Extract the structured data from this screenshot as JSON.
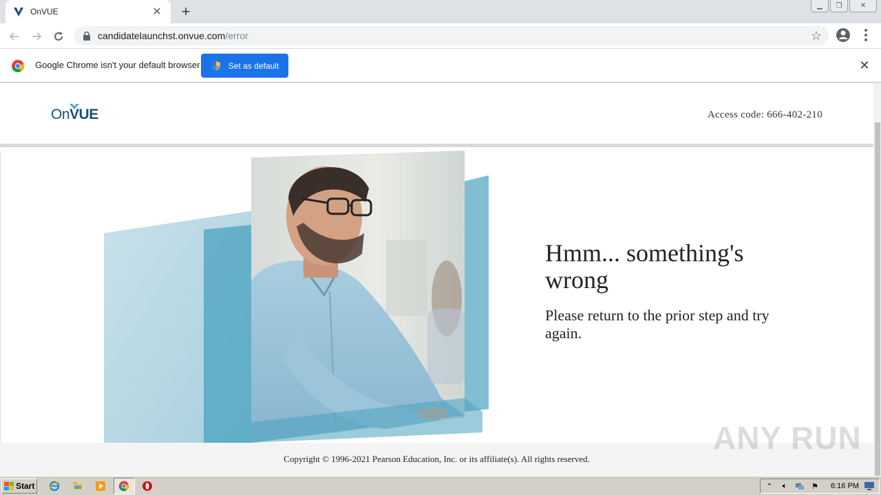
{
  "browser": {
    "tab_title": "OnVUE",
    "new_tab_symbol": "+",
    "url_host": "candidatelaunchst.onvue.com",
    "url_path": "/error",
    "infobar_text": "Google Chrome isn't your default browser",
    "set_default_label": "Set as default"
  },
  "site": {
    "logo_text_on": "On",
    "logo_text_vue": "VUE",
    "access_code": "Access code: 666-402-210",
    "error_title": "Hmm... something's wrong",
    "error_message": "Please return to the prior step and try again.",
    "copyright": "Copyright © 1996-2021 Pearson Education, Inc. or its affiliate(s). All rights reserved.",
    "brand_color": "#1c4f7c",
    "accent_color": "#4aa3bf"
  },
  "watermark": {
    "text": "ANY RUN"
  },
  "taskbar": {
    "start_label": "Start",
    "clock": "6:16 PM",
    "icons": [
      "ie-icon",
      "explorer-icon",
      "media-player-icon",
      "chrome-icon",
      "opera-icon"
    ]
  }
}
